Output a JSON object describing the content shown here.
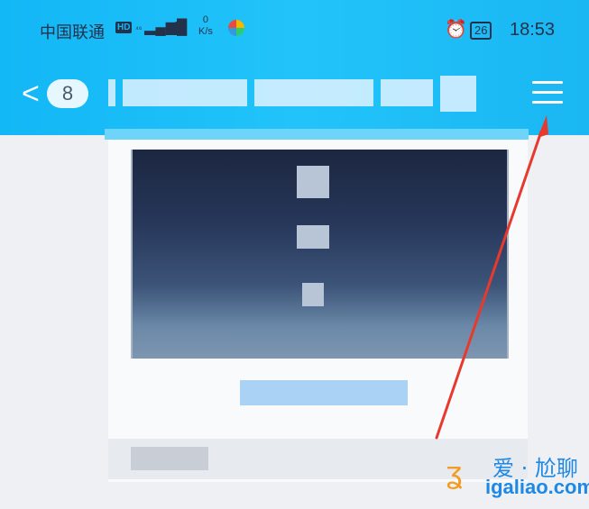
{
  "status_bar": {
    "carrier": "中国联通",
    "hd_label": "HD",
    "network": "⁴⁶",
    "speed_value": "0",
    "speed_unit": "K/s",
    "battery": "26",
    "time": "18:53"
  },
  "chat_header": {
    "unread_badge": "8"
  },
  "watermark": {
    "brand_cn": "爱 · 尬聊",
    "url": "igaliao.com"
  },
  "colors": {
    "header": "#12b7f5",
    "arrow": "#e8392f"
  }
}
